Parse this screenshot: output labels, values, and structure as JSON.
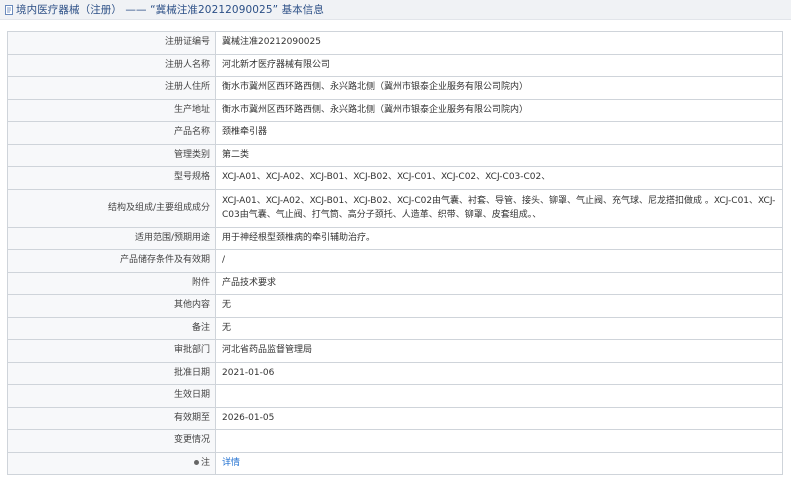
{
  "header": {
    "title": "境内医疗器械（注册） —— “冀械注准20212090025” 基本信息"
  },
  "rows": [
    {
      "label": "注册证编号",
      "value": "冀械注准20212090025"
    },
    {
      "label": "注册人名称",
      "value": "河北新才医疗器械有限公司"
    },
    {
      "label": "注册人住所",
      "value": "衡水市冀州区西环路西侧、永兴路北侧（冀州市银泰企业服务有限公司院内）"
    },
    {
      "label": "生产地址",
      "value": "衡水市冀州区西环路西侧、永兴路北侧（冀州市银泰企业服务有限公司院内）"
    },
    {
      "label": "产品名称",
      "value": "颈椎牵引器"
    },
    {
      "label": "管理类别",
      "value": "第二类"
    },
    {
      "label": "型号规格",
      "value": "XCJ-A01、XCJ-A02、XCJ-B01、XCJ-B02、XCJ-C01、XCJ-C02、XCJ-C03-C02、"
    },
    {
      "label": "结构及组成/主要组成成分",
      "value": "XCJ-A01、XCJ-A02、XCJ-B01、XCJ-B02、XCJ-C02由气囊、衬套、导管、接头、铆罩、气止阀、充气球、尼龙搭扣做成 。XCJ-C01、XCJ-C03由气囊、气止阀、打气筒、高分子颈托、人造革、织带、铆罩、皮套组成。、"
    },
    {
      "label": "适用范围/预期用途",
      "value": "用于神经根型颈椎病的牵引辅助治疗。"
    },
    {
      "label": "产品储存条件及有效期",
      "value": "/"
    },
    {
      "label": "附件",
      "value": "产品技术要求"
    },
    {
      "label": "其他内容",
      "value": "无"
    },
    {
      "label": "备注",
      "value": "无"
    },
    {
      "label": "审批部门",
      "value": "河北省药品监督管理局"
    },
    {
      "label": "批准日期",
      "value": "2021-01-06"
    },
    {
      "label": "生效日期",
      "value": ""
    },
    {
      "label": "有效期至",
      "value": "2026-01-05"
    },
    {
      "label": "变更情况",
      "value": ""
    },
    {
      "label": "注",
      "value": "详情"
    }
  ],
  "colors": {
    "header_bg": "#f0f2f5",
    "title": "#2b4f86",
    "label_bg": "#f7f8fa",
    "border": "#cfd4da",
    "link": "#1f6fd1"
  }
}
